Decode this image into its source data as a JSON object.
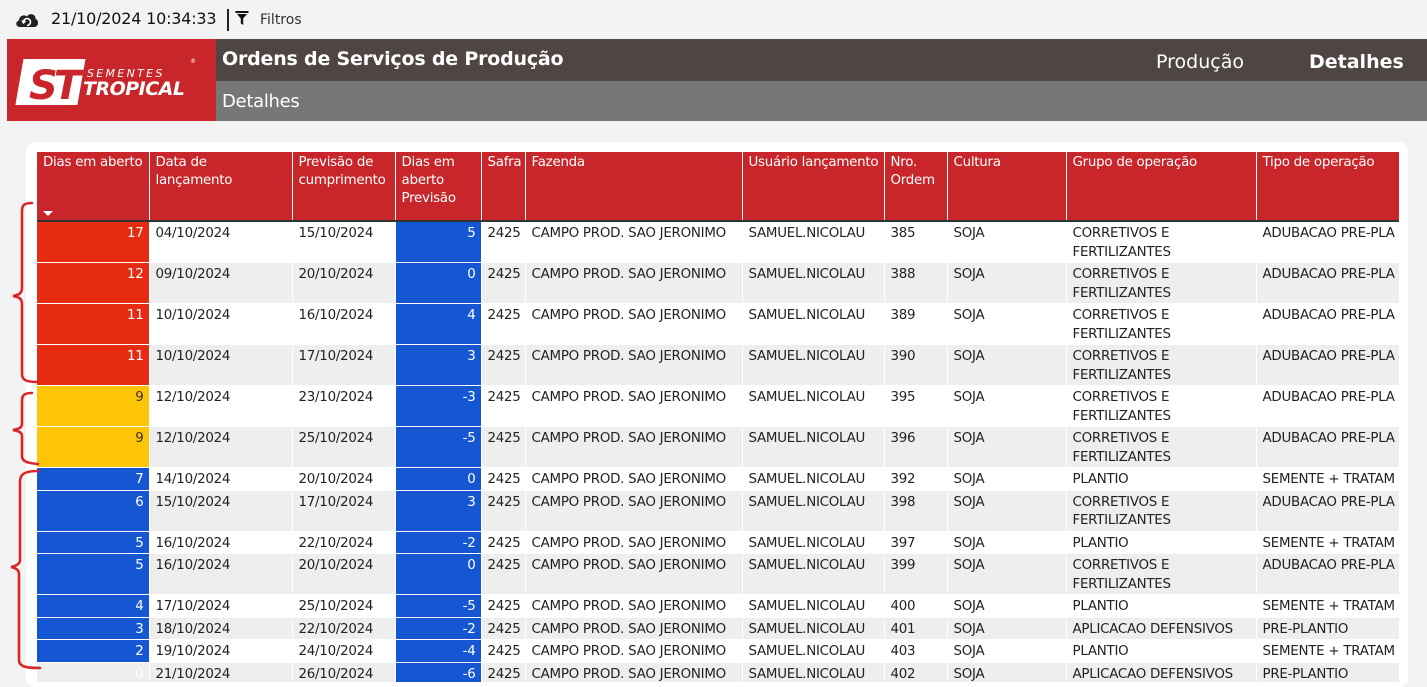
{
  "topbar": {
    "datetime": "21/10/2024 10:34:33",
    "filter_label": "Filtros",
    "cloud_icon": "cloud-refresh-icon",
    "filter_icon": "funnel-icon"
  },
  "logo": {
    "monogram": "ST",
    "brand_top": "SEMENTES",
    "brand_bottom": "TROPICAL",
    "mark": "®"
  },
  "header": {
    "title": "Ordens de Serviços de Produção",
    "subtitle": "Detalhes",
    "nav": [
      "Produção",
      "Detalhes"
    ]
  },
  "colors": {
    "brand_red": "#c8262b",
    "header_dark": "#4f4542",
    "header_gray": "#777777",
    "status_red": "#e52b12",
    "status_yellow": "#fec506",
    "status_blue": "#1557d3",
    "annotation": "#d9262a"
  },
  "table": {
    "columns": [
      "Dias em aberto",
      "Data de lançamento",
      "Previsão de cumprimento",
      "Dias em aberto Previsão",
      "Safra",
      "Fazenda",
      "Usuário lançamento",
      "Nro. Ordem",
      "Cultura",
      "Grupo de operação",
      "Tipo de operação"
    ],
    "sort_column": "Dias em aberto",
    "rows": [
      {
        "dias": "17",
        "status": "red",
        "data": "04/10/2024",
        "previsao": "15/10/2024",
        "dias_prev": "5",
        "safra": "2425",
        "fazenda": "CAMPO PROD. SAO JERONIMO",
        "usuario": "SAMUEL.NICOLAU",
        "ordem": "385",
        "cultura": "SOJA",
        "grupo": "CORRETIVOS E FERTILIZANTES",
        "tipo": "ADUBACAO PRE-PLA"
      },
      {
        "dias": "12",
        "status": "red",
        "data": "09/10/2024",
        "previsao": "20/10/2024",
        "dias_prev": "0",
        "safra": "2425",
        "fazenda": "CAMPO PROD. SAO JERONIMO",
        "usuario": "SAMUEL.NICOLAU",
        "ordem": "388",
        "cultura": "SOJA",
        "grupo": "CORRETIVOS E FERTILIZANTES",
        "tipo": "ADUBACAO PRE-PLA"
      },
      {
        "dias": "11",
        "status": "red",
        "data": "10/10/2024",
        "previsao": "16/10/2024",
        "dias_prev": "4",
        "safra": "2425",
        "fazenda": "CAMPO PROD. SAO JERONIMO",
        "usuario": "SAMUEL.NICOLAU",
        "ordem": "389",
        "cultura": "SOJA",
        "grupo": "CORRETIVOS E FERTILIZANTES",
        "tipo": "ADUBACAO PRE-PLA"
      },
      {
        "dias": "11",
        "status": "red",
        "data": "10/10/2024",
        "previsao": "17/10/2024",
        "dias_prev": "3",
        "safra": "2425",
        "fazenda": "CAMPO PROD. SAO JERONIMO",
        "usuario": "SAMUEL.NICOLAU",
        "ordem": "390",
        "cultura": "SOJA",
        "grupo": "CORRETIVOS E FERTILIZANTES",
        "tipo": "ADUBACAO PRE-PLA"
      },
      {
        "dias": "9",
        "status": "yellow",
        "data": "12/10/2024",
        "previsao": "23/10/2024",
        "dias_prev": "-3",
        "safra": "2425",
        "fazenda": "CAMPO PROD. SAO JERONIMO",
        "usuario": "SAMUEL.NICOLAU",
        "ordem": "395",
        "cultura": "SOJA",
        "grupo": "CORRETIVOS E FERTILIZANTES",
        "tipo": "ADUBACAO PRE-PLA"
      },
      {
        "dias": "9",
        "status": "yellow",
        "data": "12/10/2024",
        "previsao": "25/10/2024",
        "dias_prev": "-5",
        "safra": "2425",
        "fazenda": "CAMPO PROD. SAO JERONIMO",
        "usuario": "SAMUEL.NICOLAU",
        "ordem": "396",
        "cultura": "SOJA",
        "grupo": "CORRETIVOS E FERTILIZANTES",
        "tipo": "ADUBACAO PRE-PLA"
      },
      {
        "dias": "7",
        "status": "blue",
        "data": "14/10/2024",
        "previsao": "20/10/2024",
        "dias_prev": "0",
        "safra": "2425",
        "fazenda": "CAMPO PROD. SAO JERONIMO",
        "usuario": "SAMUEL.NICOLAU",
        "ordem": "392",
        "cultura": "SOJA",
        "grupo": "PLANTIO",
        "tipo": "SEMENTE + TRATAM"
      },
      {
        "dias": "6",
        "status": "blue",
        "data": "15/10/2024",
        "previsao": "17/10/2024",
        "dias_prev": "3",
        "safra": "2425",
        "fazenda": "CAMPO PROD. SAO JERONIMO",
        "usuario": "SAMUEL.NICOLAU",
        "ordem": "398",
        "cultura": "SOJA",
        "grupo": "CORRETIVOS E FERTILIZANTES",
        "tipo": "ADUBACAO PRE-PLA"
      },
      {
        "dias": "5",
        "status": "blue",
        "data": "16/10/2024",
        "previsao": "22/10/2024",
        "dias_prev": "-2",
        "safra": "2425",
        "fazenda": "CAMPO PROD. SAO JERONIMO",
        "usuario": "SAMUEL.NICOLAU",
        "ordem": "397",
        "cultura": "SOJA",
        "grupo": "PLANTIO",
        "tipo": "SEMENTE + TRATAM"
      },
      {
        "dias": "5",
        "status": "blue",
        "data": "16/10/2024",
        "previsao": "20/10/2024",
        "dias_prev": "0",
        "safra": "2425",
        "fazenda": "CAMPO PROD. SAO JERONIMO",
        "usuario": "SAMUEL.NICOLAU",
        "ordem": "399",
        "cultura": "SOJA",
        "grupo": "CORRETIVOS E FERTILIZANTES",
        "tipo": "ADUBACAO PRE-PLA"
      },
      {
        "dias": "4",
        "status": "blue",
        "data": "17/10/2024",
        "previsao": "25/10/2024",
        "dias_prev": "-5",
        "safra": "2425",
        "fazenda": "CAMPO PROD. SAO JERONIMO",
        "usuario": "SAMUEL.NICOLAU",
        "ordem": "400",
        "cultura": "SOJA",
        "grupo": "PLANTIO",
        "tipo": "SEMENTE + TRATAM"
      },
      {
        "dias": "3",
        "status": "blue",
        "data": "18/10/2024",
        "previsao": "22/10/2024",
        "dias_prev": "-2",
        "safra": "2425",
        "fazenda": "CAMPO PROD. SAO JERONIMO",
        "usuario": "SAMUEL.NICOLAU",
        "ordem": "401",
        "cultura": "SOJA",
        "grupo": "APLICACAO DEFENSIVOS",
        "tipo": "PRE-PLANTIO"
      },
      {
        "dias": "2",
        "status": "blue",
        "data": "19/10/2024",
        "previsao": "24/10/2024",
        "dias_prev": "-4",
        "safra": "2425",
        "fazenda": "CAMPO PROD. SAO JERONIMO",
        "usuario": "SAMUEL.NICOLAU",
        "ordem": "403",
        "cultura": "SOJA",
        "grupo": "PLANTIO",
        "tipo": "SEMENTE + TRATAM"
      },
      {
        "dias": "0",
        "status": "plain",
        "data": "21/10/2024",
        "previsao": "26/10/2024",
        "dias_prev": "-6",
        "safra": "2425",
        "fazenda": "CAMPO PROD. SAO JERONIMO",
        "usuario": "SAMUEL.NICOLAU",
        "ordem": "402",
        "cultura": "SOJA",
        "grupo": "APLICACAO DEFENSIVOS",
        "tipo": "PRE-PLANTIO"
      }
    ]
  }
}
